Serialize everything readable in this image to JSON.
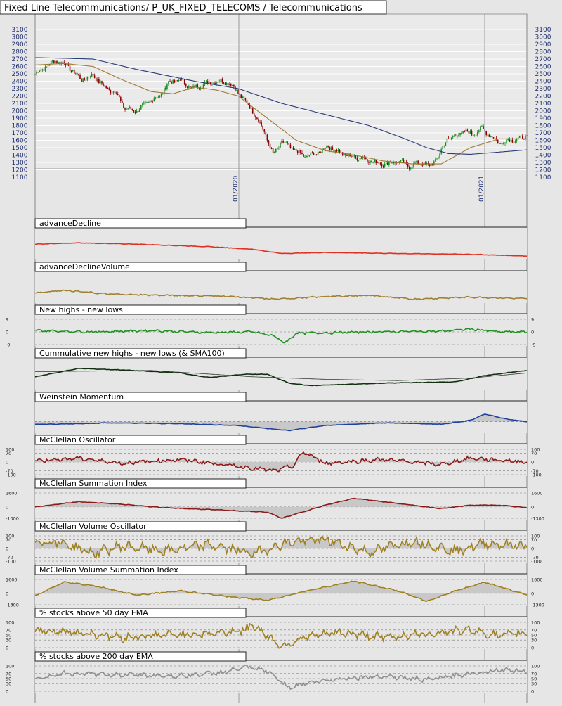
{
  "title": "Fixed Line Telecommunications/ P_UK_FIXED_TELECOMS / Telecommunications",
  "price_axis": {
    "ticks": [
      1100,
      1200,
      1300,
      1400,
      1500,
      1600,
      1700,
      1800,
      1900,
      2000,
      2100,
      2200,
      2300,
      2400,
      2500,
      2600,
      2700,
      2800,
      2900,
      3000,
      3100
    ],
    "ylim": [
      1100,
      3100
    ]
  },
  "date_labels": [
    "01/2020",
    "01/2021"
  ],
  "colors": {
    "price_up": "#1a8a1a",
    "price_down": "#8b0000",
    "sma_fast": "#a07830",
    "sma_slow": "#2a3a7a",
    "advance_decline": "#e03020",
    "advance_decline_volume": "#a08030",
    "new_highs_lows": "#209020",
    "cumulative": "#103010",
    "weinstein": "#2040a0",
    "mcclellan": "#8b1a1a",
    "volume_osc": "#a08020",
    "stocks_200": "#909090"
  },
  "chart_data": [
    {
      "type": "candlestick",
      "name": "price",
      "ylim": [
        1100,
        3100
      ],
      "keypoints": [
        [
          0,
          2500
        ],
        [
          6,
          2580
        ],
        [
          14,
          2680
        ],
        [
          20,
          2640
        ],
        [
          26,
          2540
        ],
        [
          32,
          2420
        ],
        [
          40,
          2480
        ],
        [
          48,
          2320
        ],
        [
          56,
          2240
        ],
        [
          62,
          2030
        ],
        [
          70,
          2000
        ],
        [
          78,
          2120
        ],
        [
          86,
          2200
        ],
        [
          92,
          2380
        ],
        [
          100,
          2420
        ],
        [
          108,
          2300
        ],
        [
          116,
          2360
        ],
        [
          124,
          2400
        ],
        [
          134,
          2380
        ],
        [
          142,
          2200
        ],
        [
          150,
          2000
        ],
        [
          158,
          1720
        ],
        [
          164,
          1400
        ],
        [
          170,
          1580
        ],
        [
          178,
          1480
        ],
        [
          186,
          1380
        ],
        [
          194,
          1420
        ],
        [
          202,
          1520
        ],
        [
          210,
          1430
        ],
        [
          218,
          1380
        ],
        [
          226,
          1360
        ],
        [
          234,
          1300
        ],
        [
          242,
          1280
        ],
        [
          250,
          1320
        ],
        [
          258,
          1250
        ],
        [
          266,
          1300
        ],
        [
          272,
          1250
        ],
        [
          278,
          1380
        ],
        [
          284,
          1620
        ],
        [
          290,
          1660
        ],
        [
          296,
          1720
        ],
        [
          302,
          1680
        ],
        [
          308,
          1760
        ],
        [
          314,
          1660
        ],
        [
          320,
          1560
        ],
        [
          326,
          1600
        ],
        [
          334,
          1620
        ],
        [
          339,
          1660
        ]
      ],
      "sma_fast": [
        [
          0,
          2620
        ],
        [
          20,
          2640
        ],
        [
          40,
          2600
        ],
        [
          60,
          2420
        ],
        [
          80,
          2260
        ],
        [
          95,
          2230
        ],
        [
          110,
          2320
        ],
        [
          125,
          2280
        ],
        [
          140,
          2200
        ],
        [
          160,
          1900
        ],
        [
          180,
          1600
        ],
        [
          200,
          1460
        ],
        [
          220,
          1400
        ],
        [
          240,
          1320
        ],
        [
          260,
          1280
        ],
        [
          280,
          1280
        ],
        [
          300,
          1500
        ],
        [
          320,
          1620
        ],
        [
          339,
          1620
        ]
      ],
      "sma_slow": [
        [
          0,
          2720
        ],
        [
          40,
          2700
        ],
        [
          70,
          2560
        ],
        [
          110,
          2400
        ],
        [
          140,
          2300
        ],
        [
          170,
          2100
        ],
        [
          200,
          1950
        ],
        [
          230,
          1800
        ],
        [
          255,
          1620
        ],
        [
          270,
          1500
        ],
        [
          285,
          1420
        ],
        [
          300,
          1410
        ],
        [
          320,
          1440
        ],
        [
          339,
          1470
        ]
      ]
    },
    {
      "type": "line",
      "name": "advanceDecline",
      "ylim": [
        0,
        100
      ],
      "keypoints": [
        [
          0,
          55
        ],
        [
          30,
          60
        ],
        [
          70,
          55
        ],
        [
          120,
          45
        ],
        [
          150,
          35
        ],
        [
          170,
          18
        ],
        [
          200,
          22
        ],
        [
          250,
          18
        ],
        [
          300,
          15
        ],
        [
          339,
          8
        ]
      ]
    },
    {
      "type": "line",
      "name": "advanceDeclineVolume",
      "ylim": [
        0,
        100
      ],
      "keypoints": [
        [
          0,
          35
        ],
        [
          20,
          45
        ],
        [
          50,
          30
        ],
        [
          90,
          25
        ],
        [
          130,
          22
        ],
        [
          165,
          10
        ],
        [
          200,
          20
        ],
        [
          230,
          25
        ],
        [
          260,
          10
        ],
        [
          300,
          18
        ],
        [
          339,
          12
        ]
      ]
    },
    {
      "type": "line",
      "name": "New highs - new lows",
      "ylim": [
        -9,
        9
      ],
      "y_ticks": [
        9,
        0,
        -9
      ],
      "keypoints": [
        [
          0,
          1
        ],
        [
          40,
          0
        ],
        [
          80,
          1
        ],
        [
          120,
          -0.5
        ],
        [
          150,
          0
        ],
        [
          165,
          -3
        ],
        [
          172,
          -8
        ],
        [
          180,
          -1
        ],
        [
          230,
          0
        ],
        [
          280,
          0.5
        ],
        [
          300,
          2
        ],
        [
          320,
          0
        ],
        [
          339,
          0
        ]
      ]
    },
    {
      "type": "line",
      "name": "Cummulative new highs - new lows (& SMA100)",
      "ylim": [
        0,
        100
      ],
      "keypoints": [
        [
          0,
          45
        ],
        [
          30,
          78
        ],
        [
          60,
          72
        ],
        [
          100,
          60
        ],
        [
          120,
          42
        ],
        [
          145,
          55
        ],
        [
          160,
          55
        ],
        [
          175,
          20
        ],
        [
          190,
          10
        ],
        [
          240,
          20
        ],
        [
          290,
          25
        ],
        [
          310,
          50
        ],
        [
          339,
          70
        ]
      ],
      "sma100": [
        [
          0,
          65
        ],
        [
          80,
          70
        ],
        [
          150,
          45
        ],
        [
          200,
          35
        ],
        [
          250,
          30
        ],
        [
          300,
          40
        ],
        [
          339,
          60
        ]
      ]
    },
    {
      "type": "area",
      "name": "Weinstein Momentum",
      "ylim": [
        0,
        100
      ],
      "keypoints": [
        [
          15,
          30
        ],
        [
          50,
          35
        ],
        [
          100,
          32
        ],
        [
          140,
          25
        ],
        [
          165,
          10
        ],
        [
          175,
          5
        ],
        [
          200,
          25
        ],
        [
          240,
          35
        ],
        [
          280,
          30
        ],
        [
          300,
          45
        ],
        [
          310,
          70
        ],
        [
          325,
          50
        ],
        [
          339,
          40
        ]
      ]
    },
    {
      "type": "area",
      "name": "McClellan Oscillator",
      "ylim": [
        -100,
        100
      ],
      "y_ticks": [
        100,
        70,
        0,
        -70,
        -100
      ],
      "keypoints": [
        [
          0,
          10
        ],
        [
          30,
          30
        ],
        [
          60,
          -10
        ],
        [
          100,
          20
        ],
        [
          130,
          -20
        ],
        [
          165,
          -70
        ],
        [
          178,
          -30
        ],
        [
          185,
          80
        ],
        [
          200,
          -10
        ],
        [
          240,
          20
        ],
        [
          280,
          -20
        ],
        [
          300,
          30
        ],
        [
          339,
          0
        ]
      ]
    },
    {
      "type": "area",
      "name": "McClellan Summation Index",
      "ylim": [
        -1300,
        1600
      ],
      "y_ticks": [
        1600,
        0,
        -1300
      ],
      "keypoints": [
        [
          0,
          0
        ],
        [
          30,
          600
        ],
        [
          60,
          300
        ],
        [
          90,
          -100
        ],
        [
          120,
          -300
        ],
        [
          160,
          -600
        ],
        [
          170,
          -1300
        ],
        [
          200,
          200
        ],
        [
          220,
          1000
        ],
        [
          250,
          400
        ],
        [
          280,
          -200
        ],
        [
          300,
          200
        ],
        [
          320,
          200
        ],
        [
          339,
          -100
        ]
      ]
    },
    {
      "type": "area",
      "name": "McClellan Volume Oscillator",
      "ylim": [
        -100,
        100
      ],
      "y_ticks": [
        100,
        70,
        0,
        -70,
        -100
      ],
      "keypoints": [
        [
          0,
          60
        ],
        [
          20,
          40
        ],
        [
          40,
          -40
        ],
        [
          60,
          20
        ],
        [
          90,
          -20
        ],
        [
          120,
          30
        ],
        [
          150,
          -40
        ],
        [
          175,
          50
        ],
        [
          200,
          70
        ],
        [
          230,
          -30
        ],
        [
          260,
          60
        ],
        [
          290,
          -20
        ],
        [
          310,
          40
        ],
        [
          339,
          20
        ]
      ]
    },
    {
      "type": "area",
      "name": "McClellan Volume Summation Index",
      "ylim": [
        -1300,
        1600
      ],
      "y_ticks": [
        1600,
        0,
        -1300
      ],
      "keypoints": [
        [
          0,
          -300
        ],
        [
          20,
          1300
        ],
        [
          40,
          900
        ],
        [
          70,
          -200
        ],
        [
          100,
          300
        ],
        [
          130,
          -300
        ],
        [
          160,
          -800
        ],
        [
          190,
          400
        ],
        [
          220,
          1400
        ],
        [
          250,
          300
        ],
        [
          270,
          -900
        ],
        [
          290,
          300
        ],
        [
          310,
          1300
        ],
        [
          339,
          -200
        ]
      ]
    },
    {
      "type": "line",
      "name": "% stocks above 50 day EMA",
      "ylim": [
        0,
        100
      ],
      "y_ticks": [
        100,
        70,
        50,
        30,
        0
      ],
      "keypoints": [
        [
          0,
          70
        ],
        [
          30,
          60
        ],
        [
          60,
          40
        ],
        [
          90,
          50
        ],
        [
          120,
          55
        ],
        [
          145,
          70
        ],
        [
          150,
          90
        ],
        [
          170,
          5
        ],
        [
          185,
          40
        ],
        [
          210,
          60
        ],
        [
          240,
          40
        ],
        [
          270,
          55
        ],
        [
          300,
          70
        ],
        [
          320,
          45
        ],
        [
          339,
          60
        ]
      ]
    },
    {
      "type": "line",
      "name": "% stocks above 200 day EMA",
      "ylim": [
        0,
        100
      ],
      "y_ticks": [
        100,
        70,
        50,
        30,
        0
      ],
      "keypoints": [
        [
          0,
          50
        ],
        [
          20,
          70
        ],
        [
          60,
          65
        ],
        [
          100,
          60
        ],
        [
          130,
          75
        ],
        [
          145,
          95
        ],
        [
          160,
          80
        ],
        [
          175,
          15
        ],
        [
          185,
          30
        ],
        [
          210,
          50
        ],
        [
          240,
          60
        ],
        [
          270,
          45
        ],
        [
          300,
          70
        ],
        [
          320,
          85
        ],
        [
          339,
          80
        ]
      ]
    }
  ]
}
